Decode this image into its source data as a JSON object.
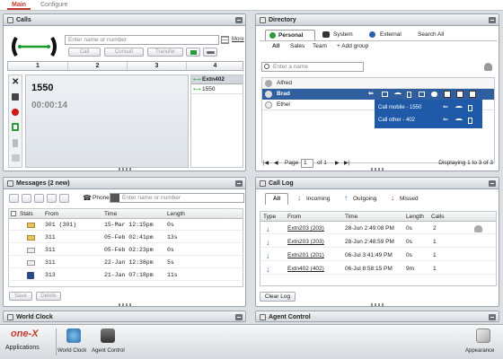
{
  "nav": {
    "main": "Main",
    "configure": "Configure"
  },
  "calls": {
    "title": "Calls",
    "search_placeholder": "Enter name or number",
    "more": "More",
    "buttons": {
      "call": "Call",
      "consult": "Consult",
      "transfer": "Transfer"
    },
    "line_tabs": [
      "1",
      "2",
      "3",
      "4"
    ],
    "current_number": "1550",
    "timer": "00:00:14",
    "side_header": "Extn402",
    "side_item": "1550"
  },
  "directory": {
    "title": "Directory",
    "tabs": [
      "Personal",
      "System",
      "External",
      "Search All"
    ],
    "groups": [
      "All",
      "Sales",
      "Team"
    ],
    "add_group": "+ Add group",
    "search_placeholder": "Enter a name",
    "contacts": [
      "Alfred",
      "Brad",
      "Ethel"
    ],
    "brad_details": [
      "Call mobile - 1550",
      "Call other - 402"
    ],
    "pager": {
      "page_label": "Page",
      "page": "1",
      "of": "of 1",
      "display": "Displaying 1 to 3 of 3"
    }
  },
  "messages": {
    "title": "Messages (2 new)",
    "phone_label": "Phone",
    "search_placeholder": "Enter name or number",
    "columns": [
      "Stats",
      "From",
      "Time",
      "Length"
    ],
    "rows": [
      {
        "from": "301 (301)",
        "time": "15-Mar 12:15pm",
        "length": "0s"
      },
      {
        "from": "311",
        "time": "05-Feb 02:41pm",
        "length": "13s"
      },
      {
        "from": "311",
        "time": "05-Feb 02:23pm",
        "length": "0s"
      },
      {
        "from": "311",
        "time": "22-Jan 12:38pm",
        "length": "5s"
      },
      {
        "from": "313",
        "time": "21-Jan 07:18pm",
        "length": "11s"
      }
    ],
    "save": "Save",
    "delete": "Delete"
  },
  "calllog": {
    "title": "Call Log",
    "tabs": [
      "All",
      "Incoming",
      "Outgoing",
      "Missed"
    ],
    "columns": [
      "Type",
      "From",
      "Time",
      "Length",
      "Calls"
    ],
    "rows": [
      {
        "from": "Extn203 (203)",
        "time": "28-Jun 2:49:08 PM",
        "length": "0s",
        "calls": "2",
        "color": "#2a6bd0"
      },
      {
        "from": "Extn203 (203)",
        "time": "28-Jun 2:48:59 PM",
        "length": "0s",
        "calls": "1",
        "color": "#2a6bd0"
      },
      {
        "from": "Extn201 (201)",
        "time": "06-Jul 3:41:49 PM",
        "length": "0s",
        "calls": "1",
        "color": "#2aa02a"
      },
      {
        "from": "Extn402 (402)",
        "time": "06-Jul 8:58:15 PM",
        "length": "9m",
        "calls": "1",
        "color": "#2a6bd0"
      }
    ],
    "clear": "Clear Log"
  },
  "world_clock": {
    "title": "World Clock"
  },
  "agent_control": {
    "title": "Agent Control"
  },
  "dock": {
    "brand": "one-X",
    "applications": "Applications",
    "items": [
      "World Clock",
      "Agent Control"
    ],
    "appearance": "Appearance"
  },
  "colors": {
    "accent": "#c0392b",
    "selection": "#2f5f9e",
    "info": "#1e5aa8"
  }
}
